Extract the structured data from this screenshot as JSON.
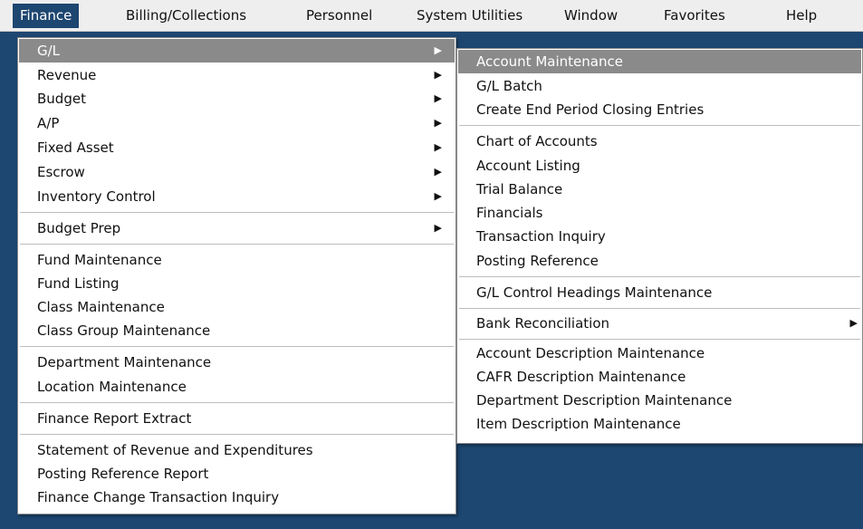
{
  "menubar": [
    {
      "label": "Finance",
      "active": true
    },
    {
      "label": "Billing/Collections"
    },
    {
      "label": "Personnel"
    },
    {
      "label": "System Utilities"
    },
    {
      "label": "Window"
    },
    {
      "label": "Favorites"
    },
    {
      "label": "Help"
    }
  ],
  "finance_menu": {
    "items": [
      {
        "label": "G/L",
        "submenu": true,
        "highlighted": true
      },
      {
        "label": "Revenue",
        "submenu": true
      },
      {
        "label": "Budget",
        "submenu": true
      },
      {
        "label": "A/P",
        "submenu": true
      },
      {
        "label": "Fixed Asset",
        "submenu": true
      },
      {
        "label": "Escrow",
        "submenu": true
      },
      {
        "label": "Inventory Control",
        "submenu": true
      },
      {
        "label": "Budget Prep",
        "submenu": true
      },
      {
        "label": "Fund Maintenance"
      },
      {
        "label": "Fund Listing"
      },
      {
        "label": "Class Maintenance"
      },
      {
        "label": "Class Group Maintenance"
      },
      {
        "label": "Department Maintenance"
      },
      {
        "label": "Location Maintenance"
      },
      {
        "label": "Finance Report Extract"
      },
      {
        "label": "Statement of Revenue and Expenditures"
      },
      {
        "label": "Posting Reference Report"
      },
      {
        "label": "Finance Change Transaction Inquiry"
      }
    ]
  },
  "gl_menu": {
    "items": [
      {
        "label": "Account Maintenance",
        "highlighted": true
      },
      {
        "label": "G/L Batch"
      },
      {
        "label": "Create End Period Closing Entries"
      },
      {
        "label": "Chart of Accounts"
      },
      {
        "label": "Account Listing"
      },
      {
        "label": "Trial Balance"
      },
      {
        "label": "Financials"
      },
      {
        "label": "Transaction Inquiry"
      },
      {
        "label": "Posting Reference"
      },
      {
        "label": "G/L Control Headings Maintenance"
      },
      {
        "label": "Bank Reconciliation",
        "submenu": true
      },
      {
        "label": "Account Description Maintenance"
      },
      {
        "label": "CAFR Description Maintenance"
      },
      {
        "label": "Department Description Maintenance"
      },
      {
        "label": "Item Description Maintenance"
      }
    ]
  },
  "submenu_arrow": "▶",
  "colors": {
    "desktop": "#1d4670",
    "highlight": "#8a8a8a",
    "menu_bg": "#ffffff",
    "menubar_bg": "#eeeeee"
  }
}
